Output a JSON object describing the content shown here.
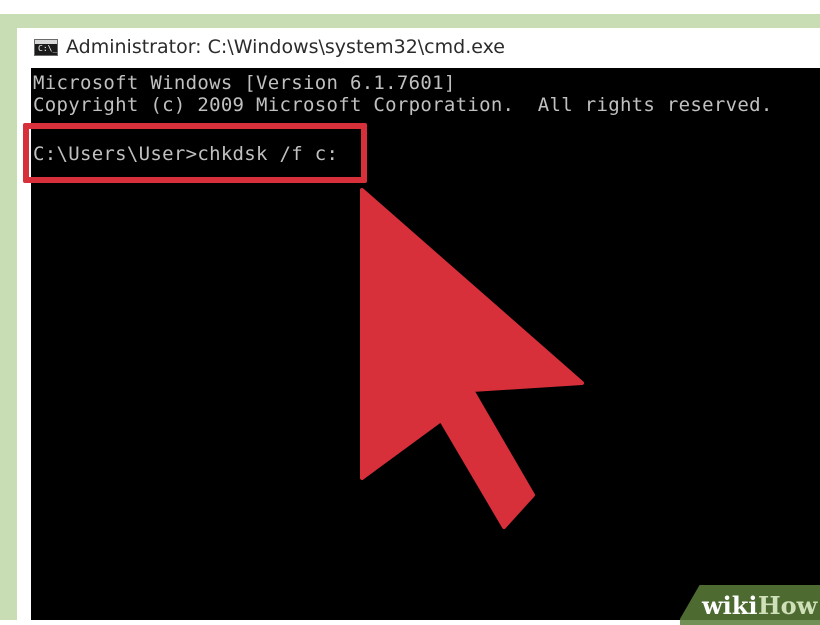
{
  "window": {
    "title": "Administrator: C:\\Windows\\system32\\cmd.exe",
    "icon": "cmd-icon"
  },
  "console": {
    "lines": [
      "Microsoft Windows [Version 6.1.7601]",
      "Copyright (c) 2009 Microsoft Corporation.  All rights reserved.",
      "C:\\Users\\User>chkdsk /f c:"
    ]
  },
  "annotation": {
    "box_color": "#d8303a",
    "arrow_color": "#d8303a",
    "arrow_icon": "pointer-arrow-icon"
  },
  "watermark": {
    "part1": "wiki",
    "part2": "How",
    "color": "#5b7e3a"
  },
  "colors": {
    "background_green": "#c9ddb4",
    "console_bg": "#000000",
    "console_text": "#c0c0c0"
  }
}
